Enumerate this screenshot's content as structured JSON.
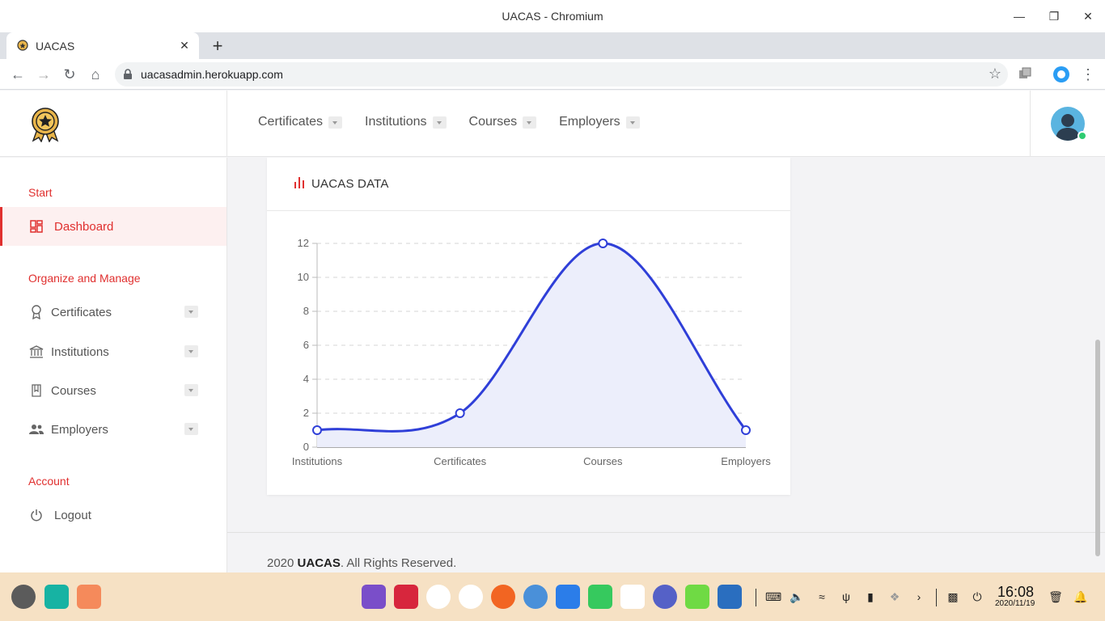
{
  "window": {
    "title": "UACAS - Chromium"
  },
  "browser": {
    "tab_title": "UACAS",
    "url": "uacasadmin.herokuapp.com"
  },
  "topnav": {
    "items": [
      {
        "label": "Certificates"
      },
      {
        "label": "Institutions"
      },
      {
        "label": "Courses"
      },
      {
        "label": "Employers"
      }
    ]
  },
  "sidebar": {
    "start_title": "Start",
    "dashboard_label": "Dashboard",
    "organize_title": "Organize and Manage",
    "items": [
      {
        "label": "Certificates",
        "icon": "award-icon"
      },
      {
        "label": "Institutions",
        "icon": "bank-icon"
      },
      {
        "label": "Courses",
        "icon": "book-icon"
      },
      {
        "label": "Employers",
        "icon": "people-icon"
      }
    ],
    "account_title": "Account",
    "logout_label": "Logout"
  },
  "card": {
    "title": "UACAS DATA"
  },
  "chart_data": {
    "type": "area",
    "categories": [
      "Institutions",
      "Certificates",
      "Courses",
      "Employers"
    ],
    "values": [
      1,
      2,
      12,
      1
    ],
    "ylim": [
      0,
      12
    ],
    "yticks": [
      "0",
      "2",
      "4",
      "6",
      "8",
      "10",
      "12"
    ],
    "grid": true,
    "line_color": "#2f3fd8",
    "fill_color": "#eceefb"
  },
  "footer": {
    "year": "2020",
    "brand": "UACAS",
    "rest": ". All Rights Reserved."
  },
  "taskbar": {
    "time": "16:08",
    "date": "2020/11/19"
  },
  "colors": {
    "accent": "#e0302f",
    "taskbar": "#f6e1c4"
  }
}
